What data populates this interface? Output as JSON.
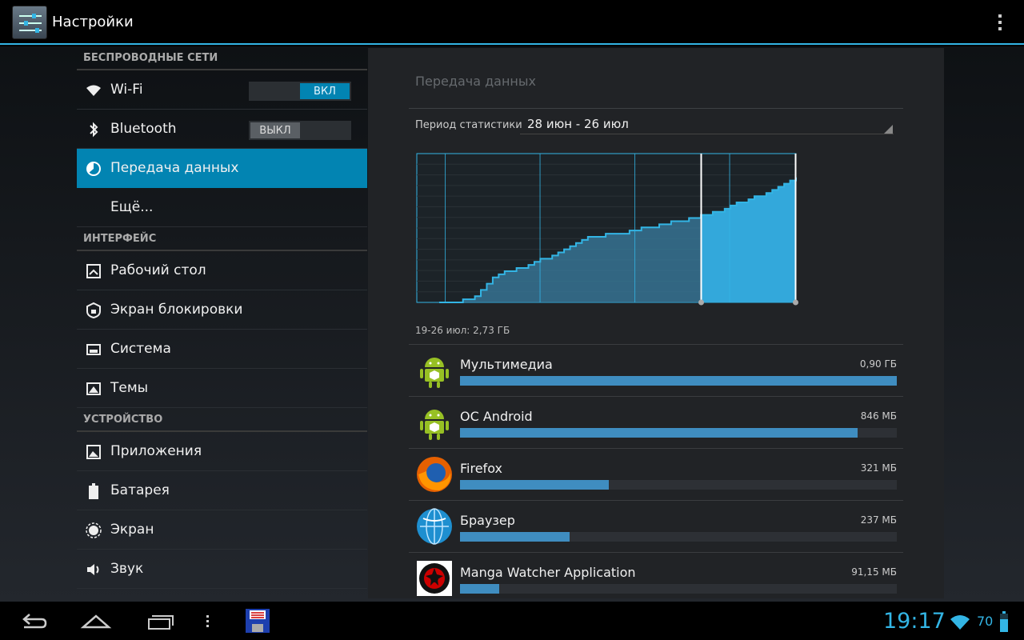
{
  "app": {
    "title": "Настройки"
  },
  "sidebar": {
    "sections": [
      {
        "header": "БЕСПРОВОДНЫЕ СЕТИ",
        "items": [
          {
            "label": "Wi-Fi",
            "icon": "wifi-icon",
            "toggle": "ВКЛ",
            "toggle_state": "on"
          },
          {
            "label": "Bluetooth",
            "icon": "bluetooth-icon",
            "toggle": "ВЫКЛ",
            "toggle_state": "off"
          },
          {
            "label": "Передача данных",
            "icon": "data-usage-icon",
            "active": true
          },
          {
            "label": "Ещё...",
            "icon": ""
          }
        ]
      },
      {
        "header": "ИНТЕРФЕЙС",
        "items": [
          {
            "label": "Рабочий стол",
            "icon": "home-screen-icon"
          },
          {
            "label": "Экран блокировки",
            "icon": "lock-icon"
          },
          {
            "label": "Система",
            "icon": "system-icon"
          },
          {
            "label": "Темы",
            "icon": "themes-icon"
          }
        ]
      },
      {
        "header": "УСТРОЙСТВО",
        "items": [
          {
            "label": "Приложения",
            "icon": "apps-icon"
          },
          {
            "label": "Батарея",
            "icon": "battery-icon"
          },
          {
            "label": "Экран",
            "icon": "display-icon"
          },
          {
            "label": "Звук",
            "icon": "sound-icon"
          }
        ]
      }
    ]
  },
  "main": {
    "title": "Передача данных",
    "cycle_label": "Период статистики",
    "cycle_value": "28 июн - 26 июл",
    "range_summary": "19-26 июл: 2,73 ГБ",
    "chart_data": {
      "type": "area",
      "cumulative_profile": [
        0,
        0.02,
        0.23,
        0.3,
        0.4,
        0.52,
        0.55,
        0.6,
        0.65,
        0.7,
        0.79,
        0.87,
        1.0
      ],
      "selection_start_fraction": 0.75,
      "selection_end_fraction": 1.0,
      "colors": {
        "fill": "#3a7ea0",
        "selected_fill": "#33a8db",
        "line": "#33b5e5"
      }
    },
    "apps": [
      {
        "name": "Мультимедиа",
        "size": "0,90 ГБ",
        "fraction": 1.0,
        "icon": "android-icon"
      },
      {
        "name": "ОС Android",
        "size": "846 МБ",
        "fraction": 0.91,
        "icon": "android-icon"
      },
      {
        "name": "Firefox",
        "size": "321 МБ",
        "fraction": 0.34,
        "icon": "firefox-icon"
      },
      {
        "name": "Браузер",
        "size": "237 МБ",
        "fraction": 0.25,
        "icon": "browser-icon"
      },
      {
        "name": "Manga Watcher Application",
        "size": "91,15 МБ",
        "fraction": 0.09,
        "icon": "manga-icon"
      }
    ]
  },
  "status": {
    "clock": "19:17",
    "battery": "70"
  },
  "colors": {
    "accent": "#33b5e5",
    "active_item": "#0284b2",
    "bar": "#3f8dc0"
  }
}
